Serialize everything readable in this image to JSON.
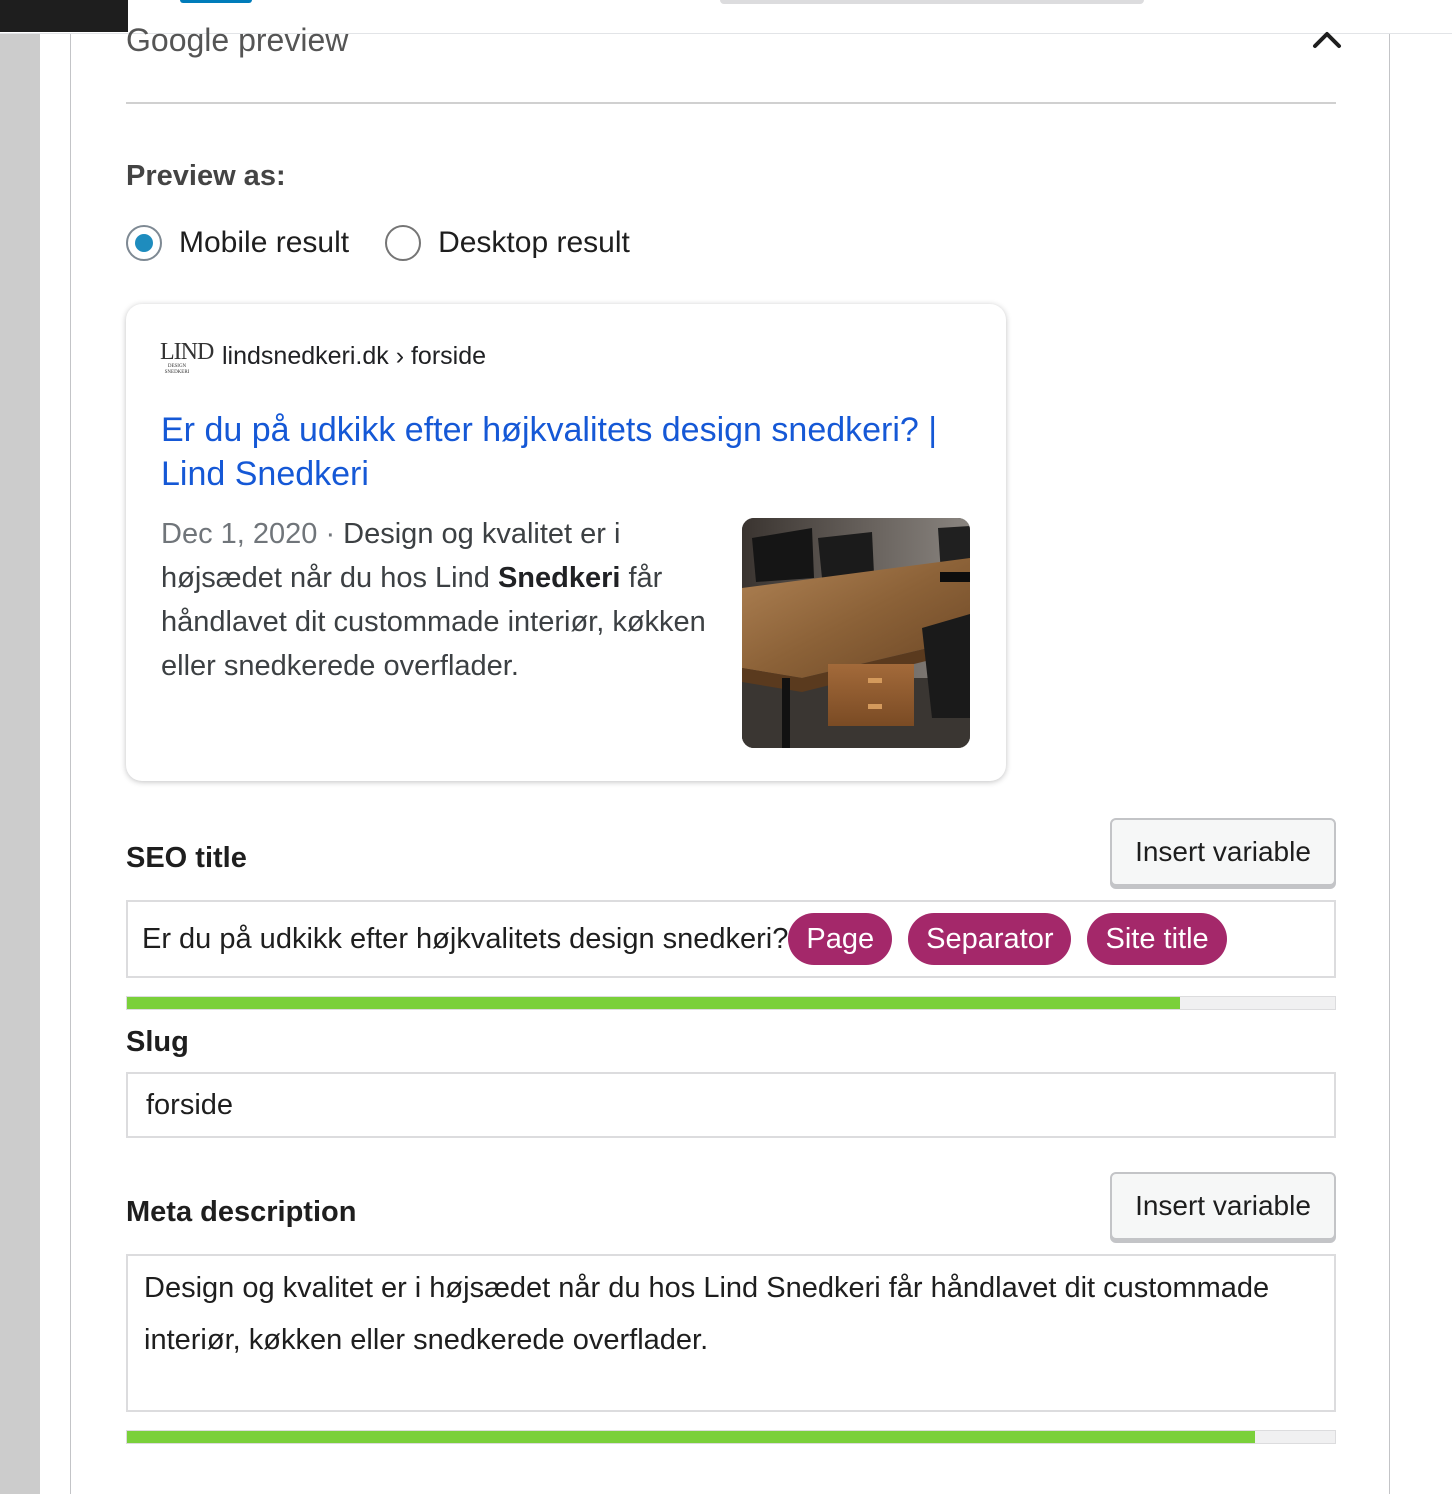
{
  "section": {
    "title": "Google preview",
    "collapse_icon": "chevron-up-icon"
  },
  "preview_as": {
    "label": "Preview as:",
    "options": [
      {
        "label": "Mobile result",
        "checked": true
      },
      {
        "label": "Desktop result",
        "checked": false
      }
    ]
  },
  "snippet": {
    "favicon_text": "LIND",
    "favicon_subtext": "DESIGN SNEDKERI",
    "breadcrumb": "lindsnedkeri.dk › forside",
    "title": "Er du på udkikk efter højkvalitets design snedkeri? | Lind Snedkeri",
    "date": "Dec 1, 2020",
    "separator": " · ",
    "description_before": "Design og kvalitet er i højsædet når du hos Lind ",
    "description_bold": "Snedkeri",
    "description_after": " får håndlavet dit custommade interiør, køkken eller snedkerede overflader.",
    "thumbnail": "wooden-table-photo"
  },
  "seo_title": {
    "label": "SEO title",
    "insert_button": "Insert variable",
    "text": "Er du på udkikk efter højkvalitets design snedkeri?",
    "variables": [
      "Page",
      "Separator",
      "Site title"
    ],
    "progress": 0.872
  },
  "slug": {
    "label": "Slug",
    "value": "forside"
  },
  "meta_description": {
    "label": "Meta description",
    "insert_button": "Insert variable",
    "value": "Design og kvalitet er i højsædet når du hos Lind Snedkeri får håndlavet dit custommade interiør, køkken eller snedkerede overflader.",
    "progress": 0.934
  },
  "colors": {
    "link": "#1558d6",
    "pill": "#a4286a",
    "progress_good": "#7ad03a",
    "radio_checked": "#1e8cbe"
  }
}
